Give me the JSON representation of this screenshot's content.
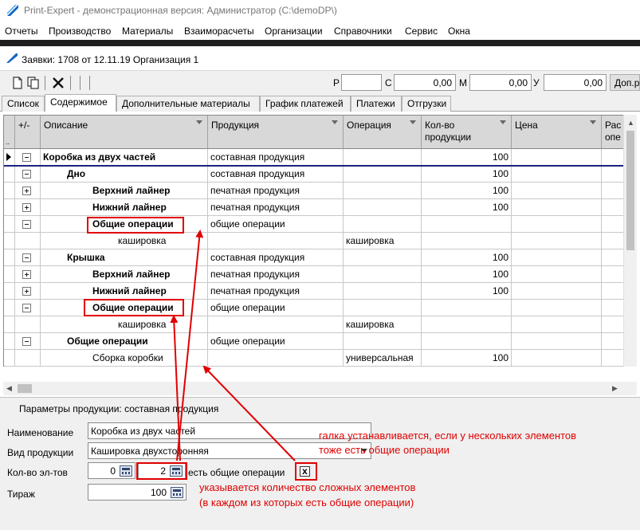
{
  "window": {
    "title": "Print-Expert - демонстрационная версия: Администратор (C:\\demoDP\\)"
  },
  "menu": [
    "Отчеты",
    "Производство",
    "Материалы",
    "Взаиморасчеты",
    "Организации",
    "Справочники",
    "Сервис",
    "Окна"
  ],
  "document": {
    "title": "Заявки: 1708 от 12.11.19  Организация 1"
  },
  "toolbar": {
    "p_label": "Р",
    "p_value": "",
    "c_label": "С",
    "c_value": "0,00",
    "m_label": "М",
    "m_value": "0,00",
    "u_label": "У",
    "u_value": "0,00",
    "extra_button": "Доп.р"
  },
  "tabs": [
    "Список",
    "Содержимое",
    "Дополнительные материалы",
    "График платежей",
    "Платежи",
    "Отгрузки"
  ],
  "active_tab": "Содержимое",
  "grid": {
    "columns": {
      "dots": "..",
      "toggle": "+/-",
      "description": "Описание",
      "product": "Продукция",
      "operation": "Операция",
      "qty": "Кол-во продукции",
      "price": "Цена",
      "extra": "Рас опе"
    },
    "rows": [
      {
        "toggle": "minus",
        "indent": 0,
        "bold": true,
        "description": "Коробка из двух частей",
        "product": "составная продукция",
        "operation": "",
        "qty": "100"
      },
      {
        "toggle": "minus",
        "indent": 1,
        "bold": true,
        "description": "Дно",
        "product": "составная продукция",
        "operation": "",
        "qty": "100"
      },
      {
        "toggle": "plus",
        "indent": 2,
        "bold": true,
        "description": "Верхний лайнер",
        "product": "печатная продукция",
        "operation": "",
        "qty": "100"
      },
      {
        "toggle": "plus",
        "indent": 2,
        "bold": true,
        "description": "Нижний лайнер",
        "product": "печатная продукция",
        "operation": "",
        "qty": "100"
      },
      {
        "toggle": "minus",
        "indent": 2,
        "bold": true,
        "description": "Общие операции",
        "product": "общие операции",
        "operation": "",
        "qty": ""
      },
      {
        "toggle": "",
        "indent": 3,
        "bold": false,
        "description": "кашировка",
        "product": "",
        "operation": "кашировка",
        "qty": ""
      },
      {
        "toggle": "minus",
        "indent": 1,
        "bold": true,
        "description": "Крышка",
        "product": "составная продукция",
        "operation": "",
        "qty": "100"
      },
      {
        "toggle": "plus",
        "indent": 2,
        "bold": true,
        "description": "Верхний лайнер",
        "product": "печатная продукция",
        "operation": "",
        "qty": "100"
      },
      {
        "toggle": "plus",
        "indent": 2,
        "bold": true,
        "description": "Нижний лайнер",
        "product": "печатная продукция",
        "operation": "",
        "qty": "100"
      },
      {
        "toggle": "minus",
        "indent": 2,
        "bold": true,
        "description": "Общие операции",
        "product": "общие операции",
        "operation": "",
        "qty": ""
      },
      {
        "toggle": "",
        "indent": 3,
        "bold": false,
        "description": "кашировка",
        "product": "",
        "operation": "кашировка",
        "qty": ""
      },
      {
        "toggle": "minus",
        "indent": 1,
        "bold": true,
        "description": "Общие операции",
        "product": "общие операции",
        "operation": "",
        "qty": ""
      },
      {
        "toggle": "",
        "indent": 2,
        "bold": false,
        "description": "Сборка коробки",
        "product": "",
        "operation": "универсальная",
        "qty": "100"
      }
    ]
  },
  "params": {
    "heading": "Параметры продукции: составная продукция",
    "name_label": "Наименование",
    "name_value": "Коробка из двух частей",
    "type_label": "Вид продукции",
    "type_value": "Кашировка двухсторонняя",
    "count_label": "Кол-во эл-тов",
    "count_value_1": "0",
    "count_value_2": "2",
    "common_ops_label": "есть общие операции",
    "common_ops_checked": "x",
    "run_label": "Тираж",
    "run_value": "100"
  },
  "annotations": {
    "note_checkbox_1": "галка устанавливается, если у нескольких элементов",
    "note_checkbox_2": "тоже есть общие операции",
    "note_count_1": "указывается количество сложных элементов",
    "note_count_2": "(в каждом из которых есть общие операции)"
  },
  "colors": {
    "annotation_red": "#e00000",
    "menu_separator": "#1f1f1f",
    "header_gray": "#d8d8d8"
  }
}
